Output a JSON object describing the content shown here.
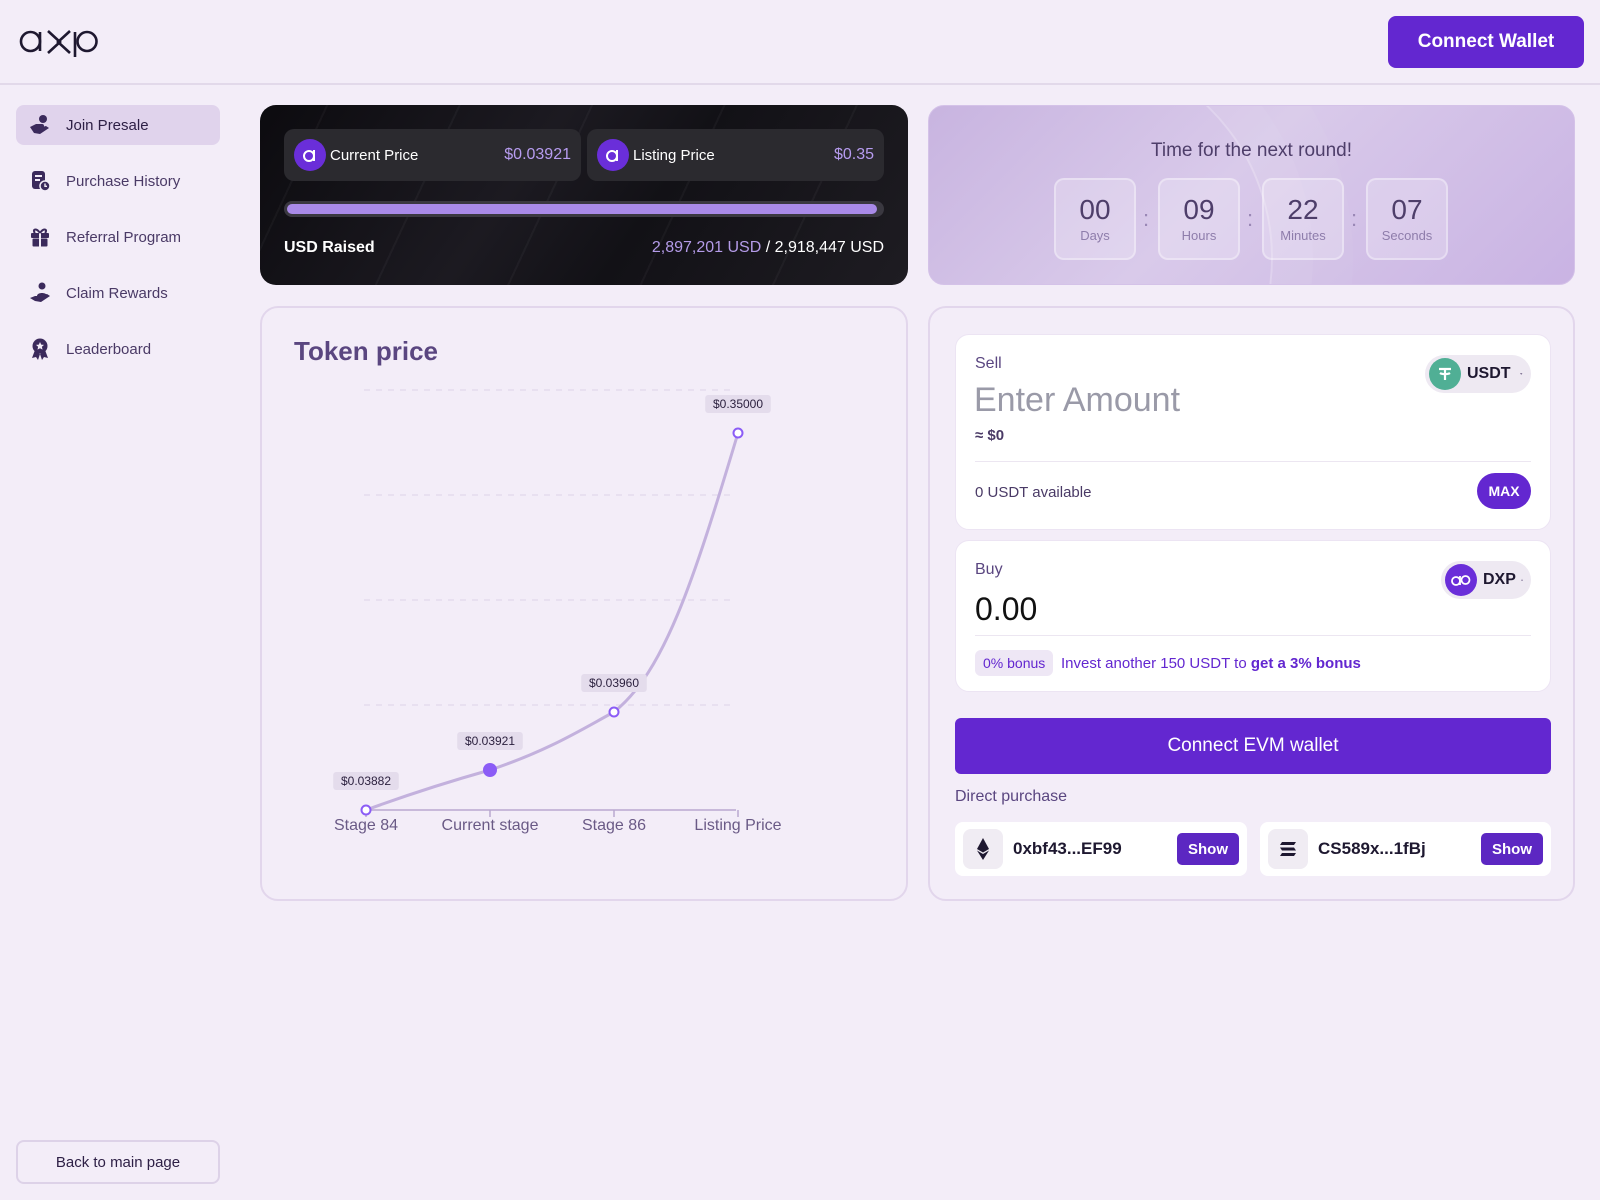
{
  "header": {
    "logo_text": "dxp",
    "connect_wallet_label": "Connect Wallet"
  },
  "sidebar": {
    "items": [
      {
        "label": "Join Presale",
        "icon": "hand-coin-icon",
        "active": true
      },
      {
        "label": "Purchase History",
        "icon": "receipt-clock-icon",
        "active": false
      },
      {
        "label": "Referral Program",
        "icon": "gift-icon",
        "active": false
      },
      {
        "label": "Claim Rewards",
        "icon": "hand-user-icon",
        "active": false
      },
      {
        "label": "Leaderboard",
        "icon": "award-icon",
        "active": false
      }
    ],
    "back_label": "Back to main page"
  },
  "price_card": {
    "current_label": "Current Price",
    "current_value": "$0.03921",
    "listing_label": "Listing Price",
    "listing_value": "$0.35",
    "progress_fraction": 0.9927,
    "raised_label": "USD Raised",
    "raised_current": "2,897,201 USD",
    "raised_sep": " / ",
    "raised_goal": "2,918,447 USD"
  },
  "timer": {
    "title": "Time for the next round!",
    "units": [
      {
        "value": "00",
        "label": "Days"
      },
      {
        "value": "09",
        "label": "Hours"
      },
      {
        "value": "22",
        "label": "Minutes"
      },
      {
        "value": "07",
        "label": "Seconds"
      }
    ]
  },
  "chart_data": {
    "type": "line",
    "title": "Token price",
    "categories": [
      "Stage 84",
      "Current stage",
      "Stage 86",
      "Listing Price"
    ],
    "values": [
      0.03882,
      0.03921,
      0.0396,
      0.35
    ],
    "labels": [
      "$0.03882",
      "$0.03921",
      "$0.03960",
      "$0.35000"
    ],
    "highlight_index": 1,
    "grid": true,
    "color": "#c3b1dd",
    "accent": "#8b5cf6"
  },
  "swap": {
    "sell_label": "Sell",
    "sell_placeholder": "Enter Amount",
    "sell_usd": "≈ $0",
    "sell_token": "USDT",
    "available": "0 USDT available",
    "max_label": "MAX",
    "buy_label": "Buy",
    "buy_amount": "0.00",
    "buy_token": "DXP",
    "bonus_badge": "0% bonus",
    "bonus_text": "Invest another 150 USDT to",
    "bonus_link": "get a 3% bonus",
    "connect_evm_label": "Connect EVM wallet",
    "direct_label": "Direct purchase",
    "addresses": [
      {
        "chain_icon": "ethereum-icon",
        "address": "0xbf43...EF99",
        "button": "Show"
      },
      {
        "chain_icon": "solana-icon",
        "address": "CS589x...1fBj",
        "button": "Show"
      }
    ]
  },
  "colors": {
    "accent": "#6327d0",
    "background": "#f3edf8",
    "usdt": "#50af95"
  }
}
